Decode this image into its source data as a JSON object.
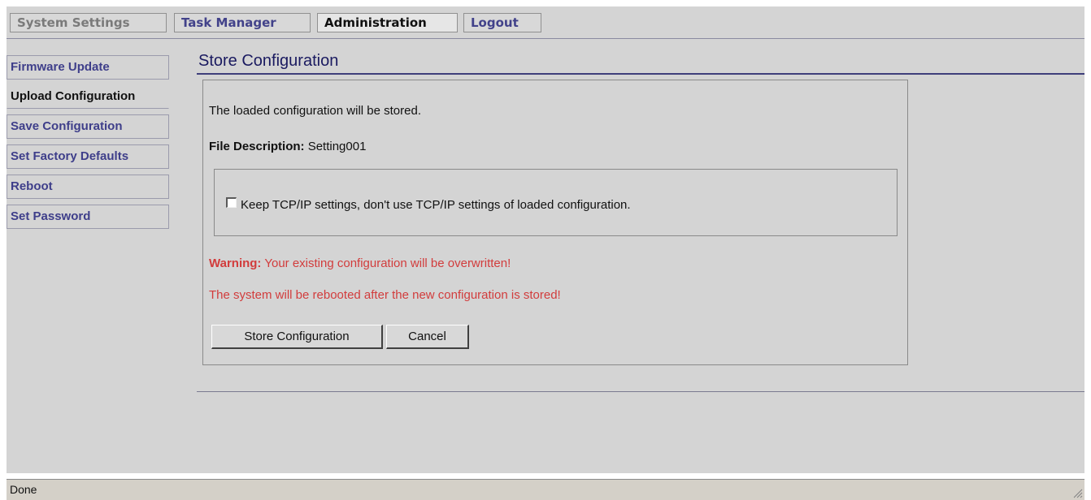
{
  "tabs": [
    {
      "label": "System Settings"
    },
    {
      "label": "Task Manager"
    },
    {
      "label": "Administration"
    },
    {
      "label": "Logout"
    }
  ],
  "sidebar": {
    "items": [
      {
        "label": "Firmware Update"
      },
      {
        "label": "Upload Configuration"
      },
      {
        "label": "Save Configuration"
      },
      {
        "label": "Set Factory Defaults"
      },
      {
        "label": "Reboot"
      },
      {
        "label": "Set Password"
      }
    ]
  },
  "main": {
    "title": "Store Configuration",
    "intro": "The loaded configuration will be stored.",
    "file_description_label": "File Description:",
    "file_description_value": "Setting001",
    "keep_tcpip_label": "Keep TCP/IP settings, don't use TCP/IP settings of loaded configuration.",
    "keep_tcpip_checked": false,
    "warning_label": "Warning:",
    "warning_text": "Your existing configuration will be overwritten!",
    "reboot_notice": "The system will be rebooted after the new configuration is stored!",
    "store_button": "Store Configuration",
    "cancel_button": "Cancel"
  },
  "status_bar": {
    "text": "Done"
  },
  "colors": {
    "link": "#3e3e8a",
    "warning": "#d23c3c",
    "title": "#1a1a60",
    "background": "#d4d4d4"
  }
}
